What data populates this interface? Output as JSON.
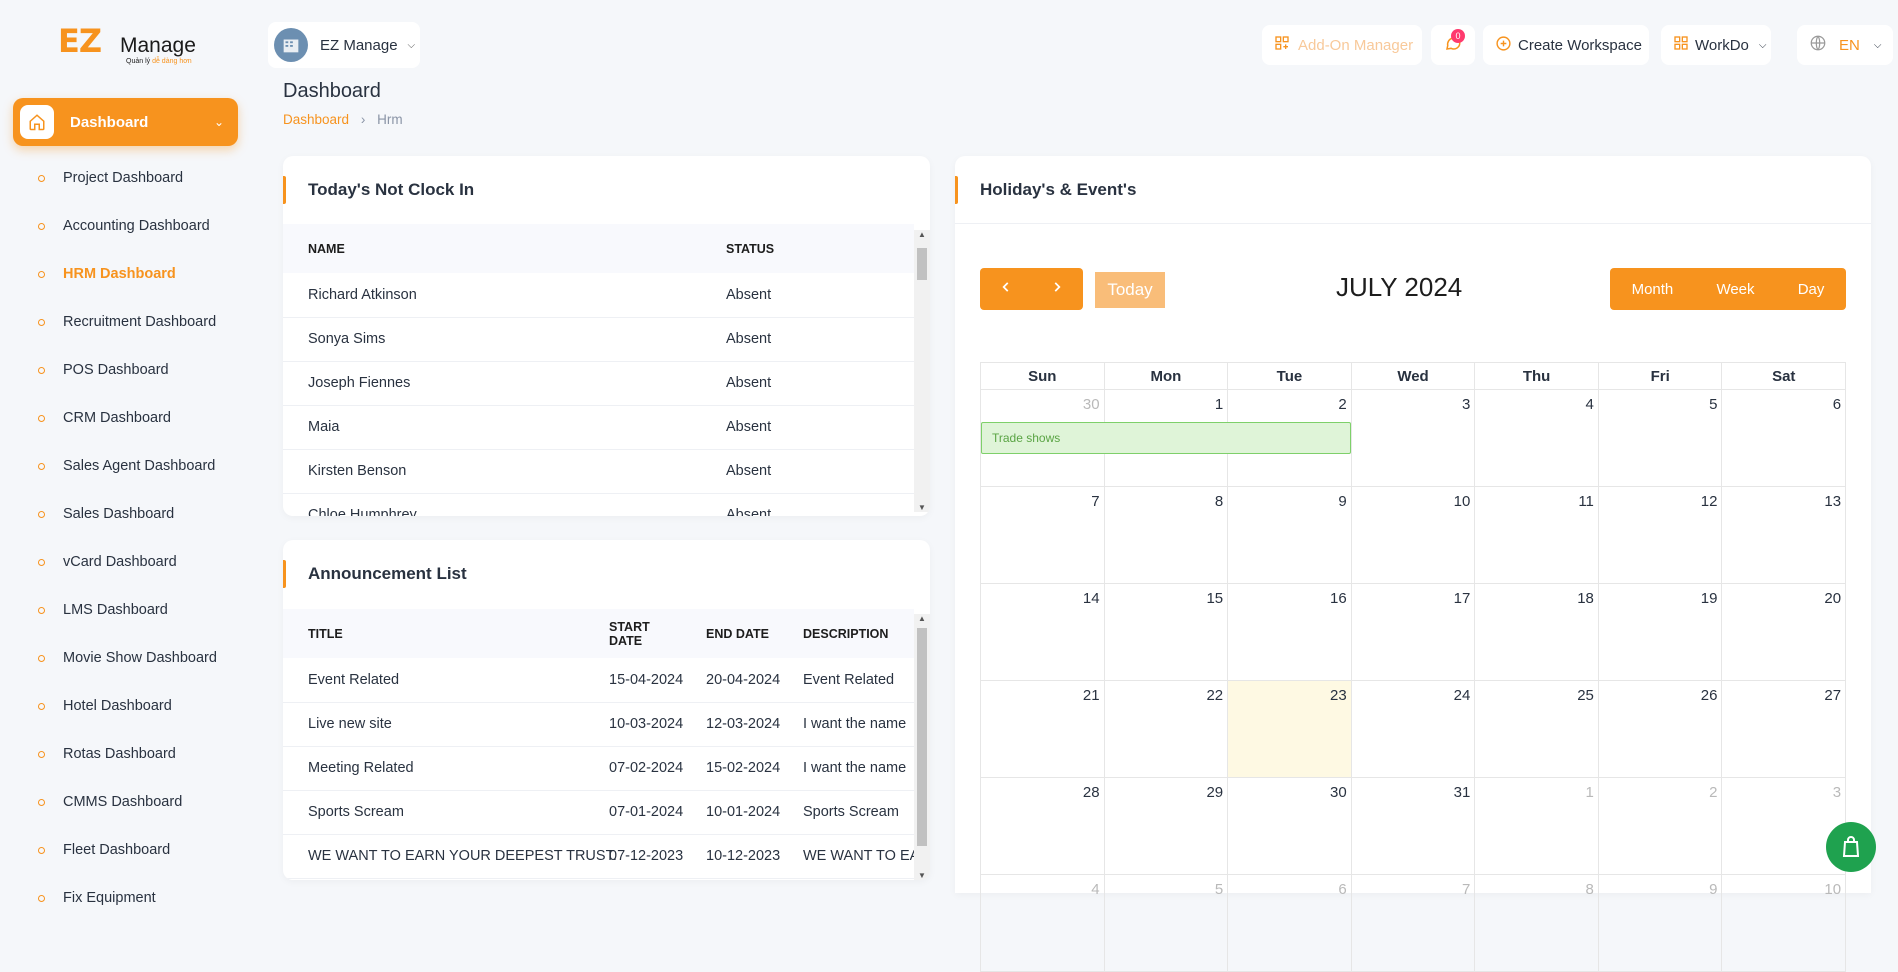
{
  "app": {
    "logo_ez": "EZ",
    "logo_manage": "Manage",
    "logo_tagline_prefix": "Quản lý ",
    "logo_tagline_accent": "dễ dàng hơn"
  },
  "sidebar": {
    "active_label": "Dashboard",
    "items": [
      {
        "label": "Project Dashboard"
      },
      {
        "label": "Accounting Dashboard"
      },
      {
        "label": "HRM Dashboard"
      },
      {
        "label": "Recruitment Dashboard"
      },
      {
        "label": "POS Dashboard"
      },
      {
        "label": "CRM Dashboard"
      },
      {
        "label": "Sales Agent Dashboard"
      },
      {
        "label": "Sales Dashboard"
      },
      {
        "label": "vCard Dashboard"
      },
      {
        "label": "LMS Dashboard"
      },
      {
        "label": "Movie Show Dashboard"
      },
      {
        "label": "Hotel Dashboard"
      },
      {
        "label": "Rotas Dashboard"
      },
      {
        "label": "CMMS Dashboard"
      },
      {
        "label": "Fleet Dashboard"
      },
      {
        "label": "Fix Equipment"
      }
    ]
  },
  "topbar": {
    "workspace_name": "EZ Manage",
    "addon_label": "Add-On Manager",
    "chat_badge": "0",
    "create_workspace": "Create Workspace",
    "workdo": "WorkDo",
    "language": "EN"
  },
  "page": {
    "title": "Dashboard",
    "breadcrumb_root": "Dashboard",
    "breadcrumb_current": "Hrm"
  },
  "clock_in": {
    "title": "Today's Not Clock In",
    "headers": [
      "NAME",
      "STATUS"
    ],
    "rows": [
      {
        "name": "Richard Atkinson",
        "status": "Absent"
      },
      {
        "name": "Sonya Sims",
        "status": "Absent"
      },
      {
        "name": "Joseph Fiennes",
        "status": "Absent"
      },
      {
        "name": "Maia",
        "status": "Absent"
      },
      {
        "name": "Kirsten Benson",
        "status": "Absent"
      },
      {
        "name": "Chloe Humphrey",
        "status": "Absent"
      }
    ]
  },
  "announcements": {
    "title": "Announcement List",
    "headers": [
      "TITLE",
      "START DATE",
      "END DATE",
      "DESCRIPTION"
    ],
    "rows": [
      {
        "title": "Event Related",
        "start": "15-04-2024",
        "end": "20-04-2024",
        "desc": "Event Related"
      },
      {
        "title": "Live new site",
        "start": "10-03-2024",
        "end": "12-03-2024",
        "desc": "I want the name"
      },
      {
        "title": "Meeting Related",
        "start": "07-02-2024",
        "end": "15-02-2024",
        "desc": "I want the name"
      },
      {
        "title": "Sports Scream",
        "start": "07-01-2024",
        "end": "10-01-2024",
        "desc": "Sports Scream"
      },
      {
        "title": "WE WANT TO EARN YOUR DEEPEST TRUST.",
        "start": "07-12-2023",
        "end": "10-12-2023",
        "desc": "WE WANT TO EAR"
      }
    ]
  },
  "calendar": {
    "title": "Holiday's & Event's",
    "today_label": "Today",
    "month_label": "JULY 2024",
    "views": [
      "Month",
      "Week",
      "Day"
    ],
    "weekdays": [
      "Sun",
      "Mon",
      "Tue",
      "Wed",
      "Thu",
      "Fri",
      "Sat"
    ],
    "event_label": "Trade shows",
    "weeks": [
      [
        "30",
        "1",
        "2",
        "3",
        "4",
        "5",
        "6"
      ],
      [
        "7",
        "8",
        "9",
        "10",
        "11",
        "12",
        "13"
      ],
      [
        "14",
        "15",
        "16",
        "17",
        "18",
        "19",
        "20"
      ],
      [
        "21",
        "22",
        "23",
        "24",
        "25",
        "26",
        "27"
      ],
      [
        "28",
        "29",
        "30",
        "31",
        "1",
        "2",
        "3"
      ],
      [
        "4",
        "5",
        "6",
        "7",
        "8",
        "9",
        "10"
      ]
    ]
  },
  "colors": {
    "accent": "#f7931e",
    "event_bg": "#dff4d8",
    "today_bg": "#fef9e3",
    "fab": "#1fa24f"
  }
}
